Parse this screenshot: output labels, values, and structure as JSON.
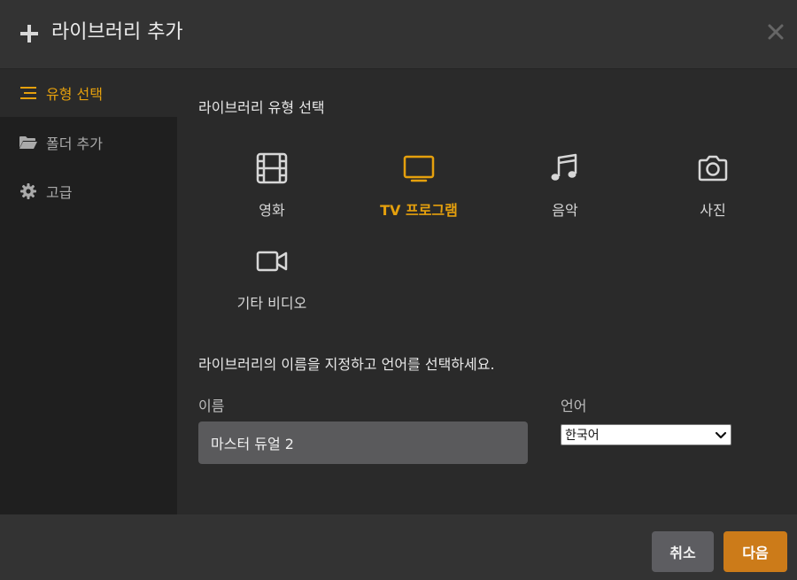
{
  "dialog": {
    "title": "라이브러리 추가",
    "icons": {
      "title": "plus-icon",
      "close": "close-icon"
    }
  },
  "sidebar": {
    "items": [
      {
        "label": "유형 선택",
        "icon": "list-icon",
        "active": true
      },
      {
        "label": "폴더 추가",
        "icon": "folder-icon",
        "active": false
      },
      {
        "label": "고급",
        "icon": "gear-icon",
        "active": false
      }
    ]
  },
  "content": {
    "section_title": "라이브러리 유형 선택",
    "types": [
      {
        "label": "영화",
        "icon": "film-icon",
        "selected": false
      },
      {
        "label": "TV 프로그램",
        "icon": "tv-icon",
        "selected": true
      },
      {
        "label": "음악",
        "icon": "music-icon",
        "selected": false
      },
      {
        "label": "사진",
        "icon": "camera-icon",
        "selected": false
      },
      {
        "label": "기타 비디오",
        "icon": "video-camera-icon",
        "selected": false
      }
    ],
    "description": "라이브러리의 이름을 지정하고 언어를 선택하세요.",
    "name_label": "이름",
    "name_value": "마스터 듀얼 2",
    "language_label": "언어",
    "language_value": "한국어"
  },
  "footer": {
    "cancel_label": "취소",
    "next_label": "다음"
  },
  "colors": {
    "accent": "#e5a00d",
    "next_button": "#cc7b19",
    "cancel_button": "#5d5d61"
  }
}
